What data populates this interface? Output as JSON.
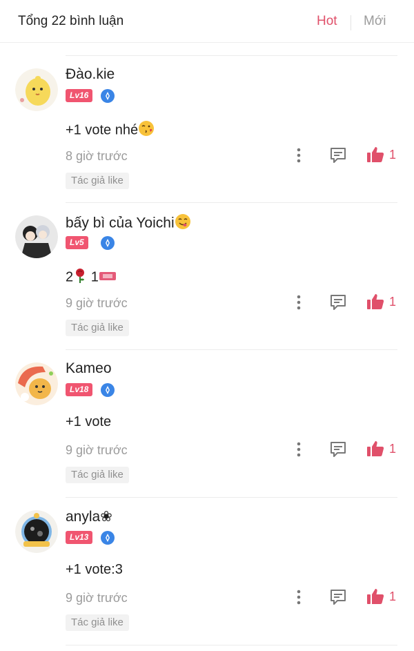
{
  "header": {
    "title": "Tổng 22 bình luận",
    "sort_hot": "Hot",
    "sort_new": "Mới"
  },
  "colors": {
    "accent": "#e0506a",
    "level_badge": "#f05570",
    "verified_badge": "#3a85e6"
  },
  "comments": [
    {
      "username": "Đào.kie",
      "level": "Lv16",
      "text": "+1 vote nhé",
      "text_emoji": "kiss-emoji",
      "time": "8 giờ trước",
      "likes": "1",
      "author_tag": "Tác giả like"
    },
    {
      "username": "bấy bì của Yoichi",
      "username_emoji": "yum-emoji",
      "level": "Lv5",
      "text_a": "2",
      "text_b": "1",
      "text_icons": [
        "rose-icon",
        "ticket-icon"
      ],
      "time": "9 giờ trước",
      "likes": "1",
      "author_tag": "Tác giả like"
    },
    {
      "username": "Kameo",
      "level": "Lv18",
      "text": "+1 vote",
      "time": "9 giờ trước",
      "likes": "1",
      "author_tag": "Tác giả like"
    },
    {
      "username": "anyla❀",
      "level": "Lv13",
      "text": "+1 vote:3",
      "time": "9 giờ trước",
      "likes": "1",
      "author_tag": "Tác giả like"
    }
  ]
}
